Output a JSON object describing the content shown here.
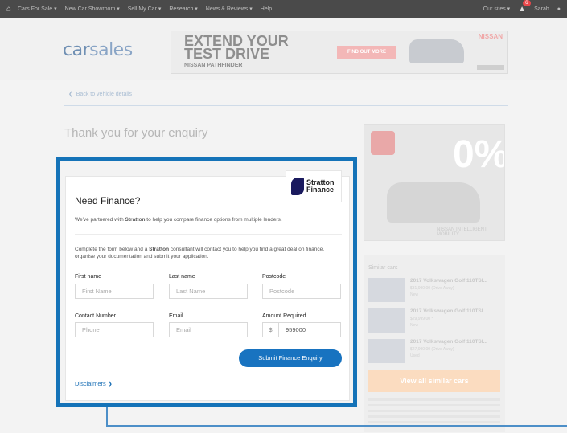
{
  "nav": {
    "items": [
      "Cars For Sale ▾",
      "New Car Showroom ▾",
      "Sell My Car ▾",
      "Research ▾",
      "News & Reviews ▾",
      "Help"
    ],
    "our_sites": "Our sites ▾",
    "notification_count": "6",
    "user": "Sarah"
  },
  "header": {
    "logo_prefix": "car",
    "logo_suffix": "sales",
    "ad": {
      "headline_1": "EXTEND YOUR",
      "headline_2": "TEST DRIVE",
      "sub": "NISSAN PATHFINDER",
      "cta": "FIND OUT MORE",
      "brand": "NISSAN"
    }
  },
  "main": {
    "back_link": "Back to vehicle details",
    "thanks": "Thank you for your enquiry"
  },
  "finance": {
    "brand_1": "Stratton",
    "brand_2": "Finance",
    "title": "Need Finance?",
    "intro_prefix": "We've partnered with ",
    "intro_brand": "Stratton",
    "intro_suffix": " to help you compare finance options from multiple lenders.",
    "desc_prefix": "Complete the form below and a ",
    "desc_brand": "Stratton",
    "desc_suffix": " consultant will contact you to help you find a great deal on finance, organise your documentation and submit your application.",
    "fields": {
      "first_name_label": "First name",
      "first_name_placeholder": "First Name",
      "last_name_label": "Last name",
      "last_name_placeholder": "Last Name",
      "postcode_label": "Postcode",
      "postcode_placeholder": "Postcode",
      "contact_label": "Contact Number",
      "contact_placeholder": "Phone",
      "email_label": "Email",
      "email_placeholder": "Email",
      "amount_label": "Amount Required",
      "amount_currency": "$",
      "amount_value": "959000"
    },
    "submit": "Submit Finance Enquiry",
    "disclaimers": "Disclaimers"
  },
  "sidebar": {
    "promo_big": "0%",
    "promo_strap": "NISSAN INTELLIGENT MOBILITY",
    "similar_title": "Similar cars",
    "similar": [
      {
        "name": "2017 Volkswagen Golf 110TSI...",
        "price": "$31,990.00 (Drive Away)",
        "condition": "New"
      },
      {
        "name": "2017 Volkswagen Golf 110TSI...",
        "price": "$29,999.00 *",
        "condition": "New"
      },
      {
        "name": "2017 Volkswagen Golf 110TSI...",
        "price": "$27,990.00 (Drive Away)",
        "condition": "Used"
      }
    ],
    "view_all": "View all similar cars"
  }
}
